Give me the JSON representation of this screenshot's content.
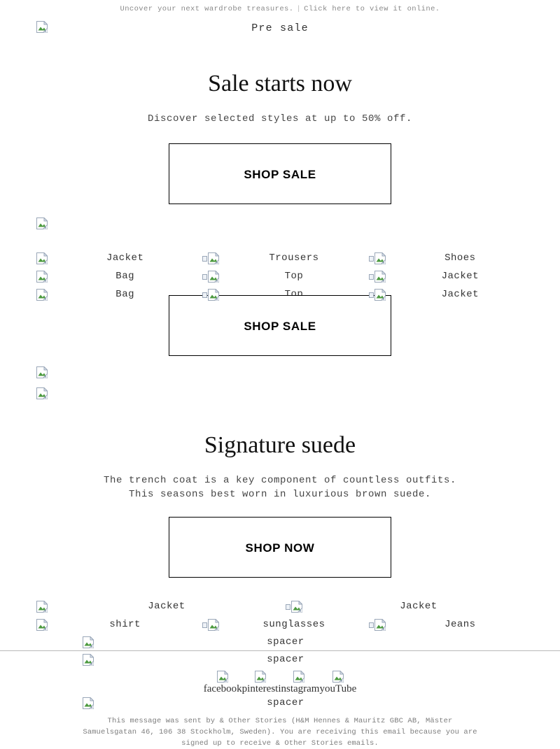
{
  "preheader": {
    "text": "Uncover your next wardrobe treasures.",
    "separator": "|",
    "link": "Click here to view it online."
  },
  "header": {
    "logo_alt": "Pre sale",
    "title": "Pre sale"
  },
  "hero": {
    "heading": "Sale starts now",
    "subheading": "Discover selected styles at up to 50% off.",
    "cta_label": "SHOP SALE"
  },
  "sale_grid": {
    "rows": [
      [
        "Jacket",
        "Trousers",
        "Shoes"
      ],
      [
        "Bag",
        "Top",
        "Jacket"
      ],
      [
        "Bag",
        "Top",
        "Jacket"
      ]
    ],
    "cta_label": "SHOP SALE"
  },
  "suede": {
    "heading": "Signature suede",
    "subheading_line1": "The trench coat is a key component of countless outfits.",
    "subheading_line2": "This seasons best worn in luxurious brown suede.",
    "cta_label": "SHOP NOW"
  },
  "suede_grid": {
    "row1": [
      "Jacket",
      "Jacket"
    ],
    "row2": [
      "shirt",
      "sunglasses",
      "Jeans"
    ]
  },
  "spacers": {
    "first": "spacer",
    "second": "spacer",
    "third": "spacer"
  },
  "social": {
    "items": [
      {
        "label": "facebook",
        "icon": "facebook-icon"
      },
      {
        "label": "pinterest",
        "icon": "pinterest-icon"
      },
      {
        "label": "instagram",
        "icon": "instagram-icon"
      },
      {
        "label": "youTube",
        "icon": "youtube-icon"
      }
    ]
  },
  "footer": {
    "legal": "This message was sent by & Other Stories (H&M Hennes & Mauritz GBC AB, Mäster Samuelsgatan 46, 106 38 Stockholm, Sweden). You are receiving this email because you are signed up to receive & Other Stories emails."
  },
  "colors": {
    "text": "#222222",
    "muted": "#8a8a8a",
    "border": "#000000",
    "divider": "#b9b9b9",
    "background": "#ffffff"
  }
}
